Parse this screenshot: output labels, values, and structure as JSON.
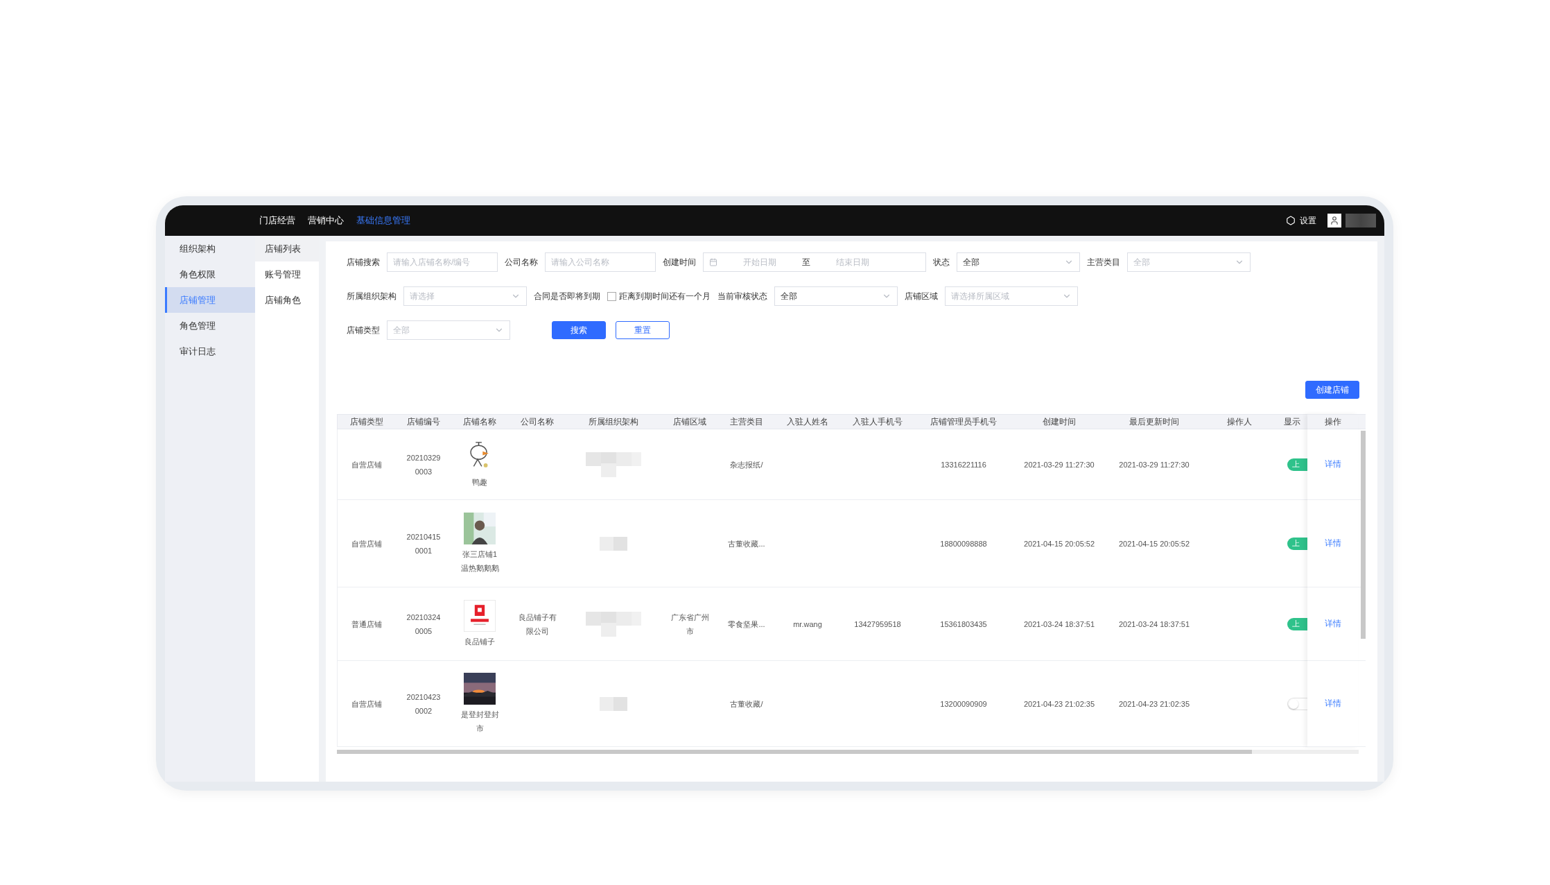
{
  "top_nav": {
    "items": [
      {
        "label": "门店经营",
        "selected": false
      },
      {
        "label": "营销中心",
        "selected": false
      },
      {
        "label": "基础信息管理",
        "selected": true
      }
    ],
    "settings_label": "设置"
  },
  "sidebar": {
    "items": [
      {
        "label": "组织架构",
        "selected": false
      },
      {
        "label": "角色权限",
        "selected": false
      },
      {
        "label": "店铺管理",
        "selected": true
      },
      {
        "label": "角色管理",
        "selected": false
      },
      {
        "label": "审计日志",
        "selected": false
      }
    ]
  },
  "subnav": {
    "items": [
      {
        "label": "店铺列表",
        "selected": true
      },
      {
        "label": "账号管理",
        "selected": false
      },
      {
        "label": "店铺角色",
        "selected": false
      }
    ]
  },
  "filter_rows": [
    [
      {
        "kind": "input",
        "label": "店铺搜索",
        "placeholder": "请输入店铺名称/编号"
      },
      {
        "kind": "input",
        "label": "公司名称",
        "placeholder": "请输入公司名称"
      },
      {
        "kind": "daterange",
        "label": "创建时间",
        "start_placeholder": "开始日期",
        "separator": "至",
        "end_placeholder": "结束日期"
      },
      {
        "kind": "select",
        "label": "状态",
        "value": "全部"
      },
      {
        "kind": "select",
        "label": "主营类目",
        "placeholder": "全部"
      }
    ],
    [
      {
        "kind": "select",
        "label": "所属组织架构",
        "placeholder": "请选择"
      },
      {
        "kind": "checkbox",
        "label": "合同是否即将到期",
        "option": "距离到期时间还有一个月",
        "checked": false
      },
      {
        "kind": "select",
        "label": "当前审核状态",
        "value": "全部"
      },
      {
        "kind": "select",
        "label": "店铺区域",
        "placeholder": "请选择所属区域",
        "wide": true
      }
    ],
    [
      {
        "kind": "select",
        "label": "店铺类型",
        "placeholder": "全部"
      },
      {
        "kind": "buttons",
        "buttons": [
          {
            "label": "搜索",
            "kind": "primary"
          },
          {
            "label": "重置",
            "kind": "default"
          }
        ]
      }
    ]
  ],
  "create_button": "创建店铺",
  "table": {
    "columns": [
      "店铺类型",
      "店铺编号",
      "店铺名称",
      "公司名称",
      "所属组织架构",
      "店铺区域",
      "主营类目",
      "入驻人姓名",
      "入驻人手机号",
      "店铺管理员手机号",
      "创建时间",
      "最后更新时间",
      "操作人",
      "显示",
      "操作"
    ],
    "rows": [
      {
        "type": "自营店铺",
        "number": "202103290003",
        "name": "鸭趣",
        "category": "杂志报纸/",
        "admin_phone": "13316221116",
        "created": "2021-03-29 11:27:30",
        "updated": "2021-03-29 11:27:30",
        "listed": true,
        "listed_label": "上",
        "action": "详情"
      },
      {
        "type": "自营店铺",
        "number": "202104150001",
        "name": "张三店铺1温热鹅鹅鹅",
        "category": "古董收藏...",
        "admin_phone": "18800098888",
        "created": "2021-04-15 20:05:52",
        "updated": "2021-04-15 20:05:52",
        "listed": true,
        "listed_label": "上",
        "action": "详情"
      },
      {
        "type": "普通店铺",
        "number": "202103240005",
        "name": "良品铺子",
        "company": "良品铺子有限公司",
        "region": "广东省广州市",
        "category": "零食坚果...",
        "contact": "mr.wang",
        "contact_phone": "13427959518",
        "admin_phone": "15361803435",
        "created": "2021-03-24 18:37:51",
        "updated": "2021-03-24 18:37:51",
        "listed": true,
        "listed_label": "上",
        "action": "详情"
      },
      {
        "type": "自营店铺",
        "number": "202104230002",
        "name": "是登封登封市",
        "category": "古董收藏/",
        "admin_phone": "13200090909",
        "created": "2021-04-23 21:02:35",
        "updated": "2021-04-23 21:02:35",
        "listed": false,
        "action": "详情"
      }
    ]
  }
}
